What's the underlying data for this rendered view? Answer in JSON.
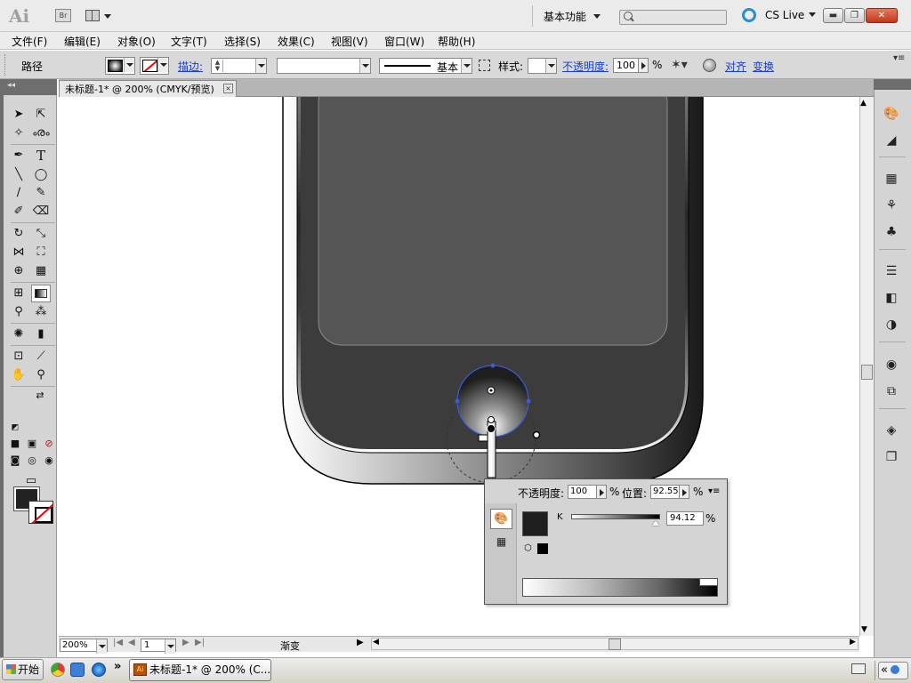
{
  "appbar": {
    "logo": "Ai",
    "bridge_label": "Br",
    "workspace_label": "基本功能",
    "cslive_label": "CS Live",
    "window_buttons": {
      "minimize": "▬",
      "maximize": "❐",
      "close": "✕"
    }
  },
  "menubar": {
    "items": [
      {
        "label": "文件(F)"
      },
      {
        "label": "编辑(E)"
      },
      {
        "label": "对象(O)"
      },
      {
        "label": "文字(T)"
      },
      {
        "label": "选择(S)"
      },
      {
        "label": "效果(C)"
      },
      {
        "label": "视图(V)"
      },
      {
        "label": "窗口(W)"
      },
      {
        "label": "帮助(H)"
      }
    ]
  },
  "control": {
    "selection_type": "路径",
    "stroke_label": "描边:",
    "brush_label": "基本",
    "style_label": "样式:",
    "opacity_label": "不透明度:",
    "opacity_value": "100",
    "opacity_unit": "%",
    "align_label": "对齐",
    "transform_label": "变换"
  },
  "document": {
    "tab_label": "未标题-1* @ 200% (CMYK/预览)",
    "tab_close": "×"
  },
  "status": {
    "zoom": "200%",
    "page": "1",
    "text": "渐变"
  },
  "gradient_panel": {
    "opacity_label": "不透明度:",
    "opacity_value": "100",
    "opacity_unit": "%",
    "position_label": "位置:",
    "position_value": "92.55",
    "position_unit": "%",
    "channel_label": "K",
    "channel_value": "94.12",
    "channel_unit": "%"
  },
  "taskbar": {
    "start_label": "开始",
    "quick_more": "»",
    "task_label": "未标题-1* @ 200% (C..."
  },
  "colors": {
    "fill": "#222222",
    "accent_link": "#1a40c8",
    "selection": "#3b5bd8",
    "phone_screen": "#555555",
    "phone_body": "#3c3c3c"
  }
}
